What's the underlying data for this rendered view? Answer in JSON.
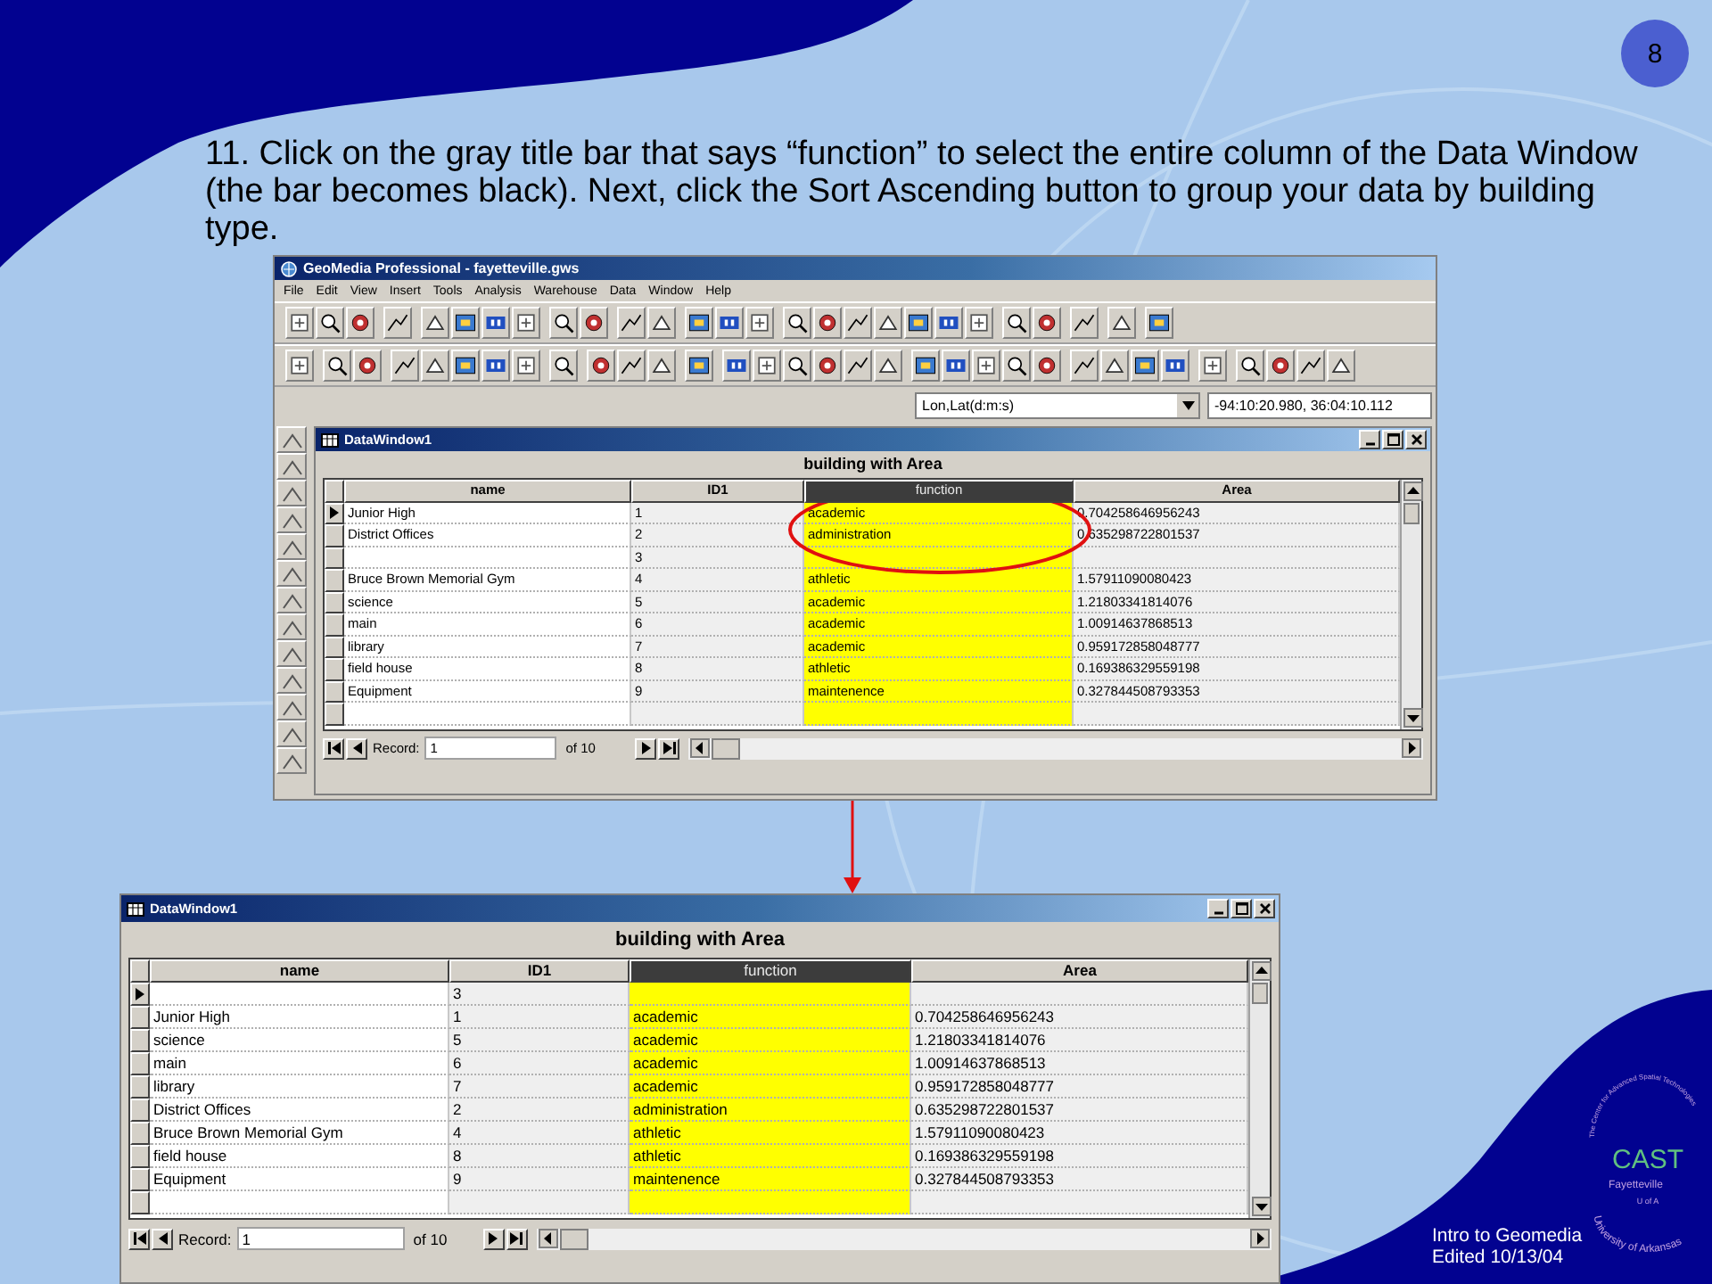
{
  "page_number": "8",
  "instruction": "11. Click on the gray title bar that says “function” to select the entire column of the Data Window (the bar becomes black). Next, click the Sort Ascending button to group your data by building type.",
  "app_window": {
    "title": "GeoMedia Professional - fayetteville.gws",
    "menu": [
      "File",
      "Edit",
      "View",
      "Insert",
      "Tools",
      "Analysis",
      "Warehouse",
      "Data",
      "Window",
      "Help"
    ],
    "coordinate_system": "Lon,Lat(d:m:s)",
    "coordinate_readout": "-94:10:20.980, 36:04:10.112",
    "data_window": {
      "title": "DataWindow1",
      "caption": "building with Area",
      "columns": [
        {
          "label": "name",
          "selected": false
        },
        {
          "label": "ID1",
          "selected": false
        },
        {
          "label": "function",
          "selected": true
        },
        {
          "label": "Area",
          "selected": false
        }
      ],
      "rows": [
        {
          "current": true,
          "cells": [
            "Junior High",
            "1",
            "academic",
            "0.704258646956243"
          ]
        },
        {
          "current": false,
          "cells": [
            "District Offices",
            "2",
            "administration",
            "0.635298722801537"
          ]
        },
        {
          "current": false,
          "cells": [
            null,
            "3",
            null,
            null
          ]
        },
        {
          "current": false,
          "cells": [
            "Bruce Brown Memorial Gym",
            "4",
            "athletic",
            "1.57911090080423"
          ]
        },
        {
          "current": false,
          "cells": [
            "science",
            "5",
            "academic",
            "1.21803341814076"
          ]
        },
        {
          "current": false,
          "cells": [
            "main",
            "6",
            "academic",
            "1.00914637868513"
          ]
        },
        {
          "current": false,
          "cells": [
            "library",
            "7",
            "academic",
            "0.959172858048777"
          ]
        },
        {
          "current": false,
          "cells": [
            "field house",
            "8",
            "athletic",
            "0.169386329559198"
          ]
        },
        {
          "current": false,
          "cells": [
            "Equipment",
            "9",
            "maintenence",
            "0.327844508793353"
          ]
        }
      ],
      "record_label": "Record:",
      "record_value": "1",
      "record_total": "of 10"
    }
  },
  "sorted_data_window": {
    "title": "DataWindow1",
    "caption": "building with Area",
    "columns": [
      {
        "label": "name",
        "selected": false
      },
      {
        "label": "ID1",
        "selected": false
      },
      {
        "label": "function",
        "selected": true
      },
      {
        "label": "Area",
        "selected": false
      }
    ],
    "rows": [
      {
        "current": true,
        "cells": [
          null,
          "3",
          null,
          null
        ]
      },
      {
        "current": false,
        "cells": [
          "Junior High",
          "1",
          "academic",
          "0.704258646956243"
        ]
      },
      {
        "current": false,
        "cells": [
          "science",
          "5",
          "academic",
          "1.21803341814076"
        ]
      },
      {
        "current": false,
        "cells": [
          "main",
          "6",
          "academic",
          "1.00914637868513"
        ]
      },
      {
        "current": false,
        "cells": [
          "library",
          "7",
          "academic",
          "0.959172858048777"
        ]
      },
      {
        "current": false,
        "cells": [
          "District Offices",
          "2",
          "administration",
          "0.635298722801537"
        ]
      },
      {
        "current": false,
        "cells": [
          "Bruce Brown Memorial Gym",
          "4",
          "athletic",
          "1.57911090080423"
        ]
      },
      {
        "current": false,
        "cells": [
          "field house",
          "8",
          "athletic",
          "0.169386329559198"
        ]
      },
      {
        "current": false,
        "cells": [
          "Equipment",
          "9",
          "maintenence",
          "0.327844508793353"
        ]
      }
    ],
    "record_label": "Record:",
    "record_value": "1",
    "record_total": "of 10"
  },
  "footer_lines": [
    "Intro to Geomedia",
    "Edited 10/13/04"
  ],
  "logo": {
    "center": "CAST",
    "ring_top": "The Center for Advanced Spatial Technologies",
    "ring_bottom": "University of Arkansas",
    "inner_top": "Fayetteville",
    "inner_bottom": "U of A"
  }
}
